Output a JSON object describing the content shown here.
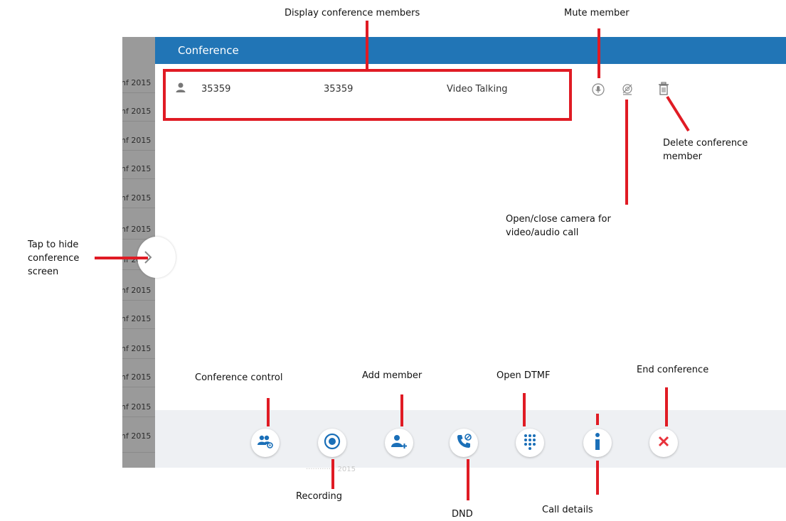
{
  "conference": {
    "title": "Conference",
    "members": [
      {
        "number": "35359",
        "name": "35359",
        "status": "Video Talking"
      }
    ]
  },
  "background_list": {
    "item_text": "nf 2015",
    "repeat_count": 13
  },
  "bottom_bar": {
    "faint_text": "············· 2015"
  },
  "annotations": {
    "display_members": "Display  conference members",
    "mute_member": "Mute member",
    "delete_member_line1": "Delete conference",
    "delete_member_line2": "member",
    "camera_line1": "Open/close camera  for",
    "camera_line2": "video/audio call",
    "hide_line1": "Tap to hide",
    "hide_line2": "conference",
    "hide_line3": "screen",
    "conference_control": "Conference control",
    "add_member": "Add member",
    "open_dtmf": "Open DTMF",
    "end_conference": "End conference",
    "recording": "Recording",
    "dnd": "DND",
    "call_details": "Call details"
  },
  "icons": {
    "member": "person-icon",
    "mute": "microphone-icon",
    "camera": "camera-off-icon",
    "delete": "trash-icon",
    "hide": "chevron-right-icon",
    "conference_control": "group-settings-icon",
    "recording": "record-icon",
    "add_member": "add-person-icon",
    "dnd": "phone-dnd-icon",
    "dtmf": "dialpad-icon",
    "details": "info-icon",
    "end": "close-icon"
  },
  "colors": {
    "header_blue": "#2175b6",
    "icon_blue": "#1a6fb8",
    "annotation_red": "#e01b24",
    "end_red": "#e8313a",
    "bottom_bar": "#eef0f3"
  }
}
